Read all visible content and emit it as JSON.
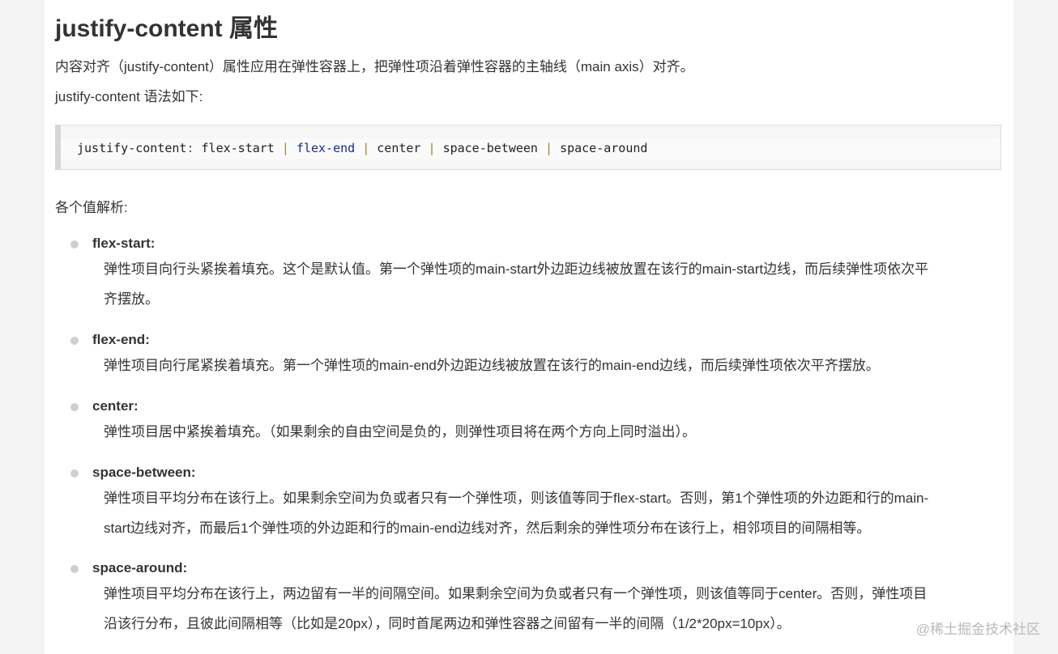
{
  "heading": "justify-content 属性",
  "intro": "内容对齐（justify-content）属性应用在弹性容器上，把弹性项沿着弹性容器的主轴线（main axis）对齐。",
  "syntax_intro": "justify-content 语法如下:",
  "code": {
    "property": "justify-content",
    "colon": ":",
    "values": [
      "flex-start",
      "flex-end",
      "center",
      "space-between",
      "space-around"
    ],
    "separator": "|"
  },
  "values_intro": "各个值解析:",
  "items": [
    {
      "name": "flex-start:",
      "lines": [
        "弹性项目向行头紧挨着填充。这个是默认值。第一个弹性项的main-start外边距边线被放置在该行的main-start边线，而后续弹性项依次平",
        "齐摆放。"
      ]
    },
    {
      "name": "flex-end:",
      "lines": [
        "弹性项目向行尾紧挨着填充。第一个弹性项的main-end外边距边线被放置在该行的main-end边线，而后续弹性项依次平齐摆放。"
      ]
    },
    {
      "name": "center:",
      "lines": [
        "弹性项目居中紧挨着填充。（如果剩余的自由空间是负的，则弹性项目将在两个方向上同时溢出）。"
      ]
    },
    {
      "name": "space-between:",
      "lines": [
        "弹性项目平均分布在该行上。如果剩余空间为负或者只有一个弹性项，则该值等同于flex-start。否则，第1个弹性项的外边距和行的main-",
        "start边线对齐，而最后1个弹性项的外边距和行的main-end边线对齐，然后剩余的弹性项分布在该行上，相邻项目的间隔相等。"
      ]
    },
    {
      "name": "space-around:",
      "lines": [
        "弹性项目平均分布在该行上，两边留有一半的间隔空间。如果剩余空间为负或者只有一个弹性项，则该值等同于center。否则，弹性项目",
        "沿该行分布，且彼此间隔相等（比如是20px），同时首尾两边和弹性容器之间留有一半的间隔（1/2*20px=10px）。"
      ]
    }
  ],
  "watermark": "@稀土掘金技术社区"
}
